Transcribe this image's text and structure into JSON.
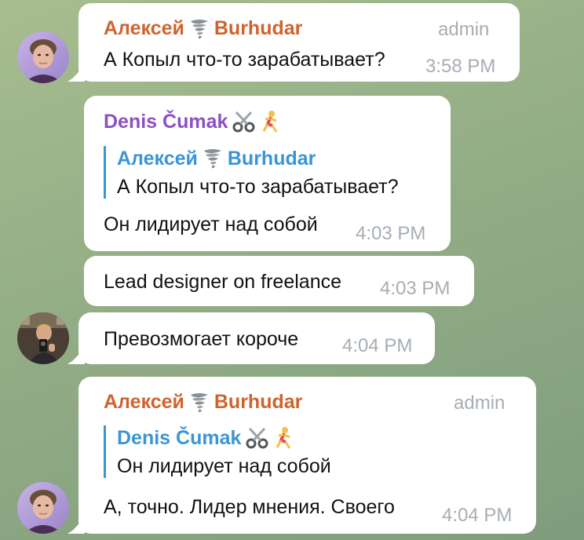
{
  "messages": [
    {
      "sender": "Алексей 🌪 Burhudar",
      "sender_first": "Алексей",
      "sender_last": "Burhudar",
      "role": "admin",
      "text": "А Копыл что-то зарабатывает?",
      "time": "3:58 PM"
    },
    {
      "sender_name": "Denis Čumak",
      "reply_to": {
        "sender_first": "Алексей",
        "sender_last": "Burhudar",
        "text": "А Копыл что-то зарабатывает?"
      },
      "text": "Он лидирует над собой",
      "time": "4:03 PM"
    },
    {
      "text": "Lead designer on freelance",
      "time": "4:03 PM"
    },
    {
      "text": "Превозмогает короче",
      "time": "4:04 PM"
    },
    {
      "sender_first": "Алексей",
      "sender_last": "Burhudar",
      "role": "admin",
      "reply_to": {
        "sender_name": "Denis Čumak",
        "text": "Он лидирует над собой"
      },
      "text": "А, точно. Лидер мнения. Своего",
      "time": "4:04 PM"
    }
  ],
  "colors": {
    "sender_orange": "#d0632c",
    "sender_purple": "#8e4fc3",
    "reply_blue": "#3a95d5",
    "meta_gray": "#a6adb4",
    "bubble": "#ffffff"
  },
  "icons": [
    "tornado-emoji-icon",
    "scissors-emoji-icon",
    "running-woman-emoji-icon"
  ]
}
